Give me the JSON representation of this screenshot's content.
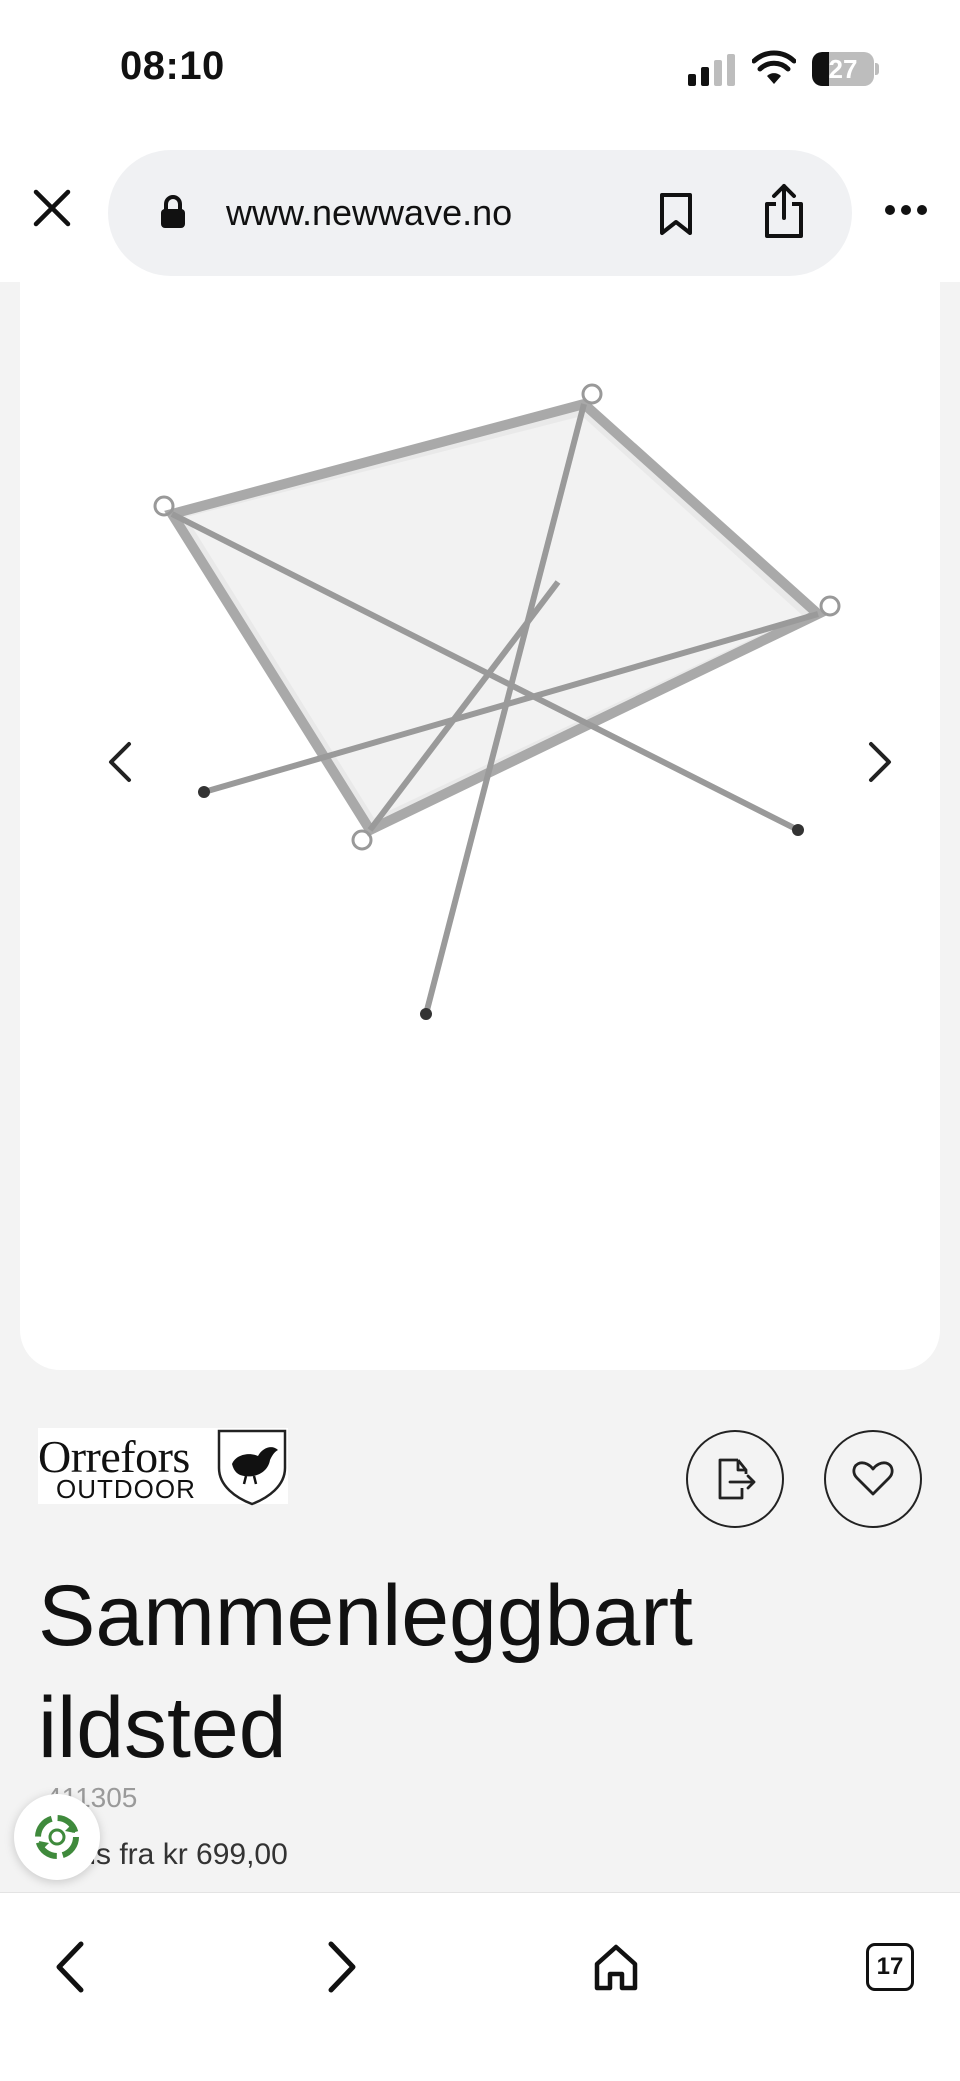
{
  "status_bar": {
    "time": "08:10",
    "battery_level": 27,
    "battery_text": "27"
  },
  "browser": {
    "url": "www.newwave.no",
    "icons": {
      "close": "close-icon",
      "lock": "lock-icon",
      "bookmark": "bookmark-icon",
      "share": "share-icon",
      "more": "more-icon"
    }
  },
  "product": {
    "brand_name": "Orrefors",
    "brand_sub": "OUTDOOR",
    "title": "Sammenleggbart ildsted",
    "sku": "411305",
    "price_text": ". pris fra kr 699,00"
  },
  "toolbar": {
    "tab_count": "17"
  },
  "colors": {
    "page_background": "#f3f3f3",
    "url_pill": "#f0f1f3",
    "text": "#111111"
  }
}
